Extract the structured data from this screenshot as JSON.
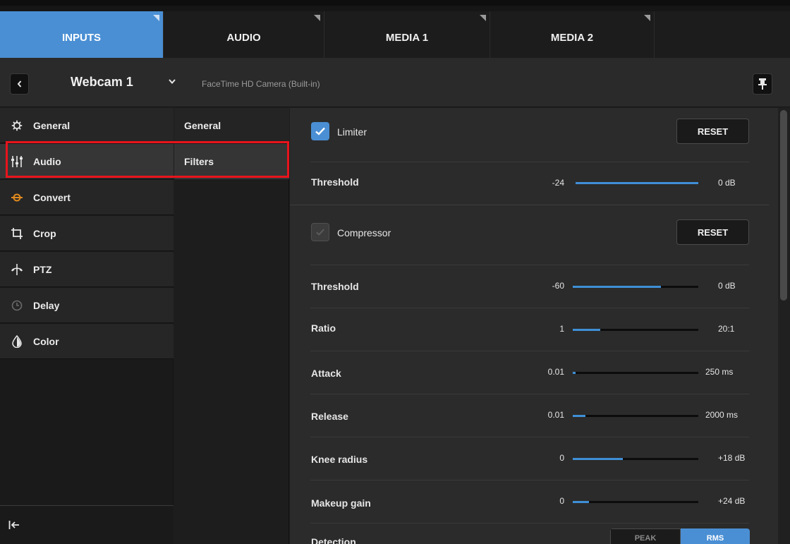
{
  "tabs": [
    {
      "label": "INPUTS",
      "active": true
    },
    {
      "label": "AUDIO",
      "active": false
    },
    {
      "label": "MEDIA 1",
      "active": false
    },
    {
      "label": "MEDIA 2",
      "active": false
    }
  ],
  "source": {
    "name": "Webcam 1",
    "device": "FaceTime HD Camera (Built-in)"
  },
  "categories": [
    {
      "label": "General",
      "icon": "gear-icon"
    },
    {
      "label": "Audio",
      "icon": "mixer-sliders-icon",
      "selected": true
    },
    {
      "label": "Convert",
      "icon": "convert-icon"
    },
    {
      "label": "Crop",
      "icon": "crop-icon"
    },
    {
      "label": "PTZ",
      "icon": "ptz-icon"
    },
    {
      "label": "Delay",
      "icon": "clock-icon"
    },
    {
      "label": "Color",
      "icon": "color-drop-icon"
    }
  ],
  "subnav": [
    {
      "label": "General"
    },
    {
      "label": "Filters",
      "selected": true
    }
  ],
  "limiter": {
    "label": "Limiter",
    "enabled": true,
    "reset_label": "RESET",
    "threshold": {
      "label": "Threshold",
      "min": "-24",
      "max": "0 dB",
      "fill": 1.0
    }
  },
  "compressor": {
    "label": "Compressor",
    "enabled": false,
    "reset_label": "RESET",
    "params": [
      {
        "label": "Threshold",
        "min": "-60",
        "max": "0 dB",
        "fill": 0.7
      },
      {
        "label": "Ratio",
        "min": "1",
        "max": "20:1",
        "fill": 0.22
      },
      {
        "label": "Attack",
        "min": "0.01",
        "max": "250 ms",
        "fill": 0.02
      },
      {
        "label": "Release",
        "min": "0.01",
        "max": "2000 ms",
        "fill": 0.1
      },
      {
        "label": "Knee radius",
        "min": "0",
        "max": "+18 dB",
        "fill": 0.4
      },
      {
        "label": "Makeup gain",
        "min": "0",
        "max": "+24 dB",
        "fill": 0.13
      }
    ],
    "detection": {
      "label": "Detection",
      "options": [
        "PEAK",
        "RMS"
      ],
      "selected": "RMS"
    }
  },
  "colors": {
    "accent": "#4a8fd4",
    "highlight": "#e8141c"
  }
}
